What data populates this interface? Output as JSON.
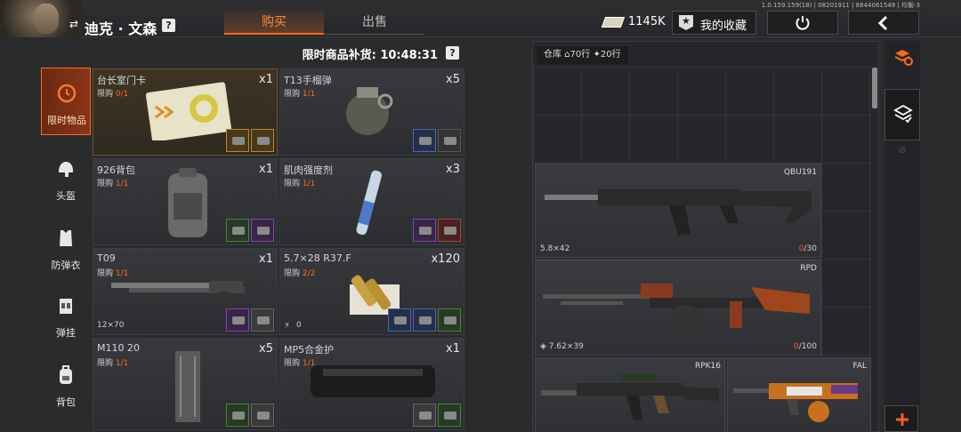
{
  "header": {
    "character_name": "迪克 · 文森",
    "help": "?",
    "tabs": [
      {
        "label": "购买",
        "active": true
      },
      {
        "label": "出售",
        "active": false
      }
    ],
    "currency_amount": "1145K",
    "favorites_label": "我的收藏",
    "version_text": "1.0.159.159(18) | 08201911 | 88440615​49 | 均衡-3"
  },
  "shop": {
    "restock_label": "限时商品补货: 10:48:31",
    "limit_label": "限购",
    "items": [
      {
        "name": "台长室门卡",
        "qty": "x1",
        "limit": "0/1",
        "sub": ""
      },
      {
        "name": "T13手榴弹",
        "qty": "x5",
        "limit": "1/1",
        "sub": ""
      },
      {
        "name": "926背包",
        "qty": "x1",
        "limit": "1/1",
        "sub": ""
      },
      {
        "name": "肌肉强度剂",
        "qty": "x3",
        "limit": "1/1",
        "sub": ""
      },
      {
        "name": "T09",
        "qty": "x1",
        "limit": "1/1",
        "sub": "12×70"
      },
      {
        "name": "5.7×28 R37.F",
        "qty": "x120",
        "limit": "2/2",
        "sub": "0"
      },
      {
        "name": "M110 20",
        "qty": "x5",
        "limit": "1/1",
        "sub": ""
      },
      {
        "name": "MP5合金护",
        "qty": "x1",
        "limit": "1/1",
        "sub": ""
      }
    ]
  },
  "nav": {
    "items": [
      {
        "label": "限时物品",
        "icon": "clock-icon",
        "active": true
      },
      {
        "label": "头盔",
        "icon": "helmet-icon",
        "active": false
      },
      {
        "label": "防弹衣",
        "icon": "vest-icon",
        "active": false
      },
      {
        "label": "弹挂",
        "icon": "chest-rig-icon",
        "active": false
      },
      {
        "label": "背包",
        "icon": "backpack-icon",
        "active": false
      }
    ]
  },
  "storage": {
    "label": "仓库",
    "rows_home": "70行",
    "rows_extra": "20行",
    "weapons": [
      {
        "name": "QBU191",
        "caliber": "5.8×42",
        "ammo_current": "0",
        "ammo_max": "/30"
      },
      {
        "name": "RPD",
        "caliber": "7.62×39",
        "ammo_current": "0",
        "ammo_max": "/100"
      },
      {
        "name": "RPK16",
        "caliber": "",
        "ammo_current": "",
        "ammo_max": ""
      },
      {
        "name": "FAL",
        "caliber": "",
        "ammo_current": "",
        "ammo_max": ""
      }
    ]
  },
  "colors": {
    "accent": "#ff6a1a",
    "limit_value": "#ff6a1a",
    "ammo_empty": "#ff5a3a"
  }
}
